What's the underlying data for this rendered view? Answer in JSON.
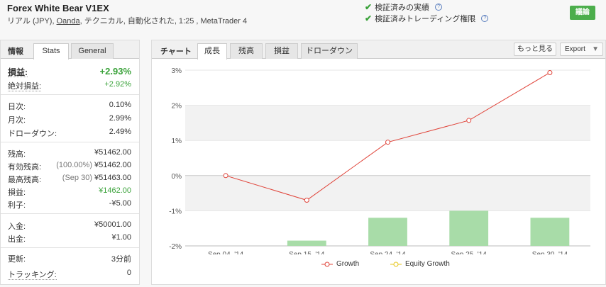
{
  "header": {
    "title": "Forex White Bear V1EX",
    "subtitle_prefix": "リアル (JPY), ",
    "broker": "Oanda",
    "subtitle_suffix": ", テクニカル, 自動化された, 1:25 , MetaTrader 4",
    "verified_track": "検証済みの実績",
    "verified_privileges": "検証済みトレーディング権限",
    "discuss_label": "議論",
    "check_icon": "check-icon",
    "help_icon": "help-icon"
  },
  "info": {
    "tab_label": "情報",
    "tabs": [
      "Stats",
      "General"
    ],
    "gain": {
      "label": "損益:",
      "value": "+2.93%"
    },
    "abs_gain": {
      "label": "絶対損益:",
      "value": "+2.92%"
    },
    "daily": {
      "label": "日次:",
      "value": "0.10%"
    },
    "monthly": {
      "label": "月次:",
      "value": "2.99%"
    },
    "drawdown": {
      "label": "ドローダウン:",
      "value": "2.49%"
    },
    "balance": {
      "label": "残高:",
      "value": "¥51462.00"
    },
    "equity": {
      "label": "有効残高:",
      "sub": "(100.00%)",
      "value": "¥51462.00"
    },
    "highest": {
      "label": "最高残高:",
      "sub": "(Sep 30)",
      "value": "¥51463.00"
    },
    "profit": {
      "label": "損益:",
      "value": "¥1462.00"
    },
    "interest": {
      "label": "利子:",
      "value": "-¥5.00"
    },
    "deposits": {
      "label": "入金:",
      "value": "¥50001.00"
    },
    "withdrawals": {
      "label": "出金:",
      "value": "¥1.00"
    },
    "updated": {
      "label": "更新:",
      "value": "3分前"
    },
    "tracking": {
      "label": "トラッキング:",
      "value": "0"
    }
  },
  "chart_panel": {
    "tab_label": "チャート",
    "tabs": [
      "成長",
      "残高",
      "損益",
      "ドローダウン"
    ],
    "more_label": "もっと見る",
    "export_label": "Export"
  },
  "chart_data": {
    "type": "line",
    "categories": [
      "Sep 04, '14",
      "Sep 15, '14",
      "Sep 24, '14",
      "Sep 25, '14",
      "Sep 30, '14"
    ],
    "series": [
      {
        "name": "Growth",
        "type": "line",
        "color": "#e0443a",
        "x_index": [
          0,
          1,
          2,
          3,
          4
        ],
        "values": [
          0,
          -0.7,
          0.95,
          1.57,
          2.93
        ]
      },
      {
        "name": "Equity Growth",
        "type": "line",
        "color": "#e6c619",
        "values": []
      },
      {
        "name": "",
        "type": "bar",
        "color": "#a8dca8",
        "x_index": [
          1,
          2,
          3,
          4
        ],
        "values": [
          -1.85,
          -1.2,
          -1.0,
          -1.2
        ]
      }
    ],
    "y_ticks": [
      "3%",
      "2%",
      "1%",
      "0%",
      "-1%",
      "-2%"
    ],
    "ylim": [
      -2,
      3
    ],
    "legend_position": "bottom"
  }
}
